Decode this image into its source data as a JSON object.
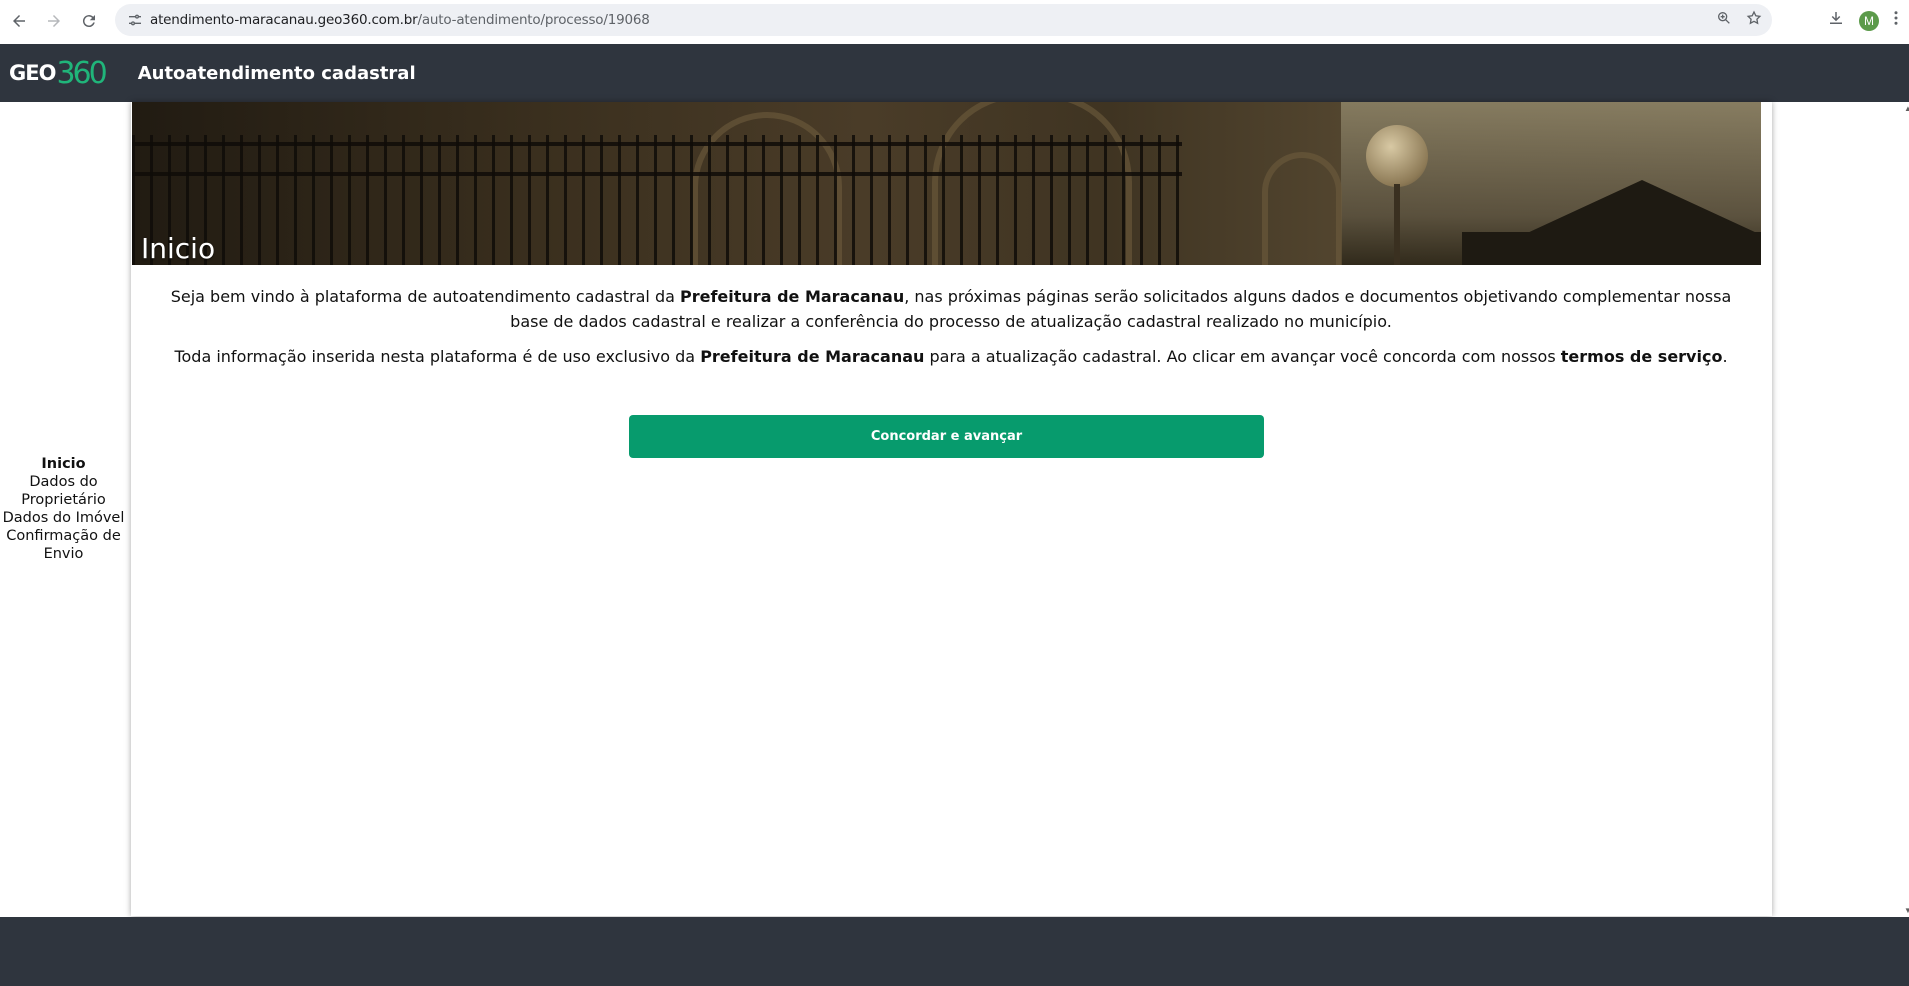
{
  "browser": {
    "url_host": "atendimento-maracanau.geo360.com.br",
    "url_path": "/auto-atendimento/processo/19068",
    "profile_initial": "M"
  },
  "header": {
    "logo_text": "GEO",
    "logo_num": "360",
    "title": "Autoatendimento cadastral"
  },
  "steps": [
    {
      "label": "Inicio",
      "active": true
    },
    {
      "label": "Dados do Proprietário"
    },
    {
      "label": "Dados do Imóvel"
    },
    {
      "label": "Confirmação de Envio"
    }
  ],
  "main": {
    "banner_title": "Inicio",
    "p1_a": "Seja bem vindo à plataforma de autoatendimento cadastral da ",
    "p1_b": "Prefeitura de Maracanau",
    "p1_c": ", nas próximas páginas serão solicitados alguns dados e documentos objetivando complementar nossa base de dados cadastral e realizar a conferência do processo de atualização cadastral realizado no município.",
    "p2_a": "Toda informação inserida nesta plataforma é de uso exclusivo da ",
    "p2_b": "Prefeitura de Maracanau",
    "p2_c": " para a atualização cadastral. Ao clicar em avançar você concorda com nossos ",
    "p2_d": "termos de serviço",
    "p2_e": ".",
    "cta_label": "Concordar e avançar"
  },
  "colors": {
    "header_bg": "#2f353e",
    "accent": "#079b6d",
    "logo_accent": "#20b57a"
  }
}
